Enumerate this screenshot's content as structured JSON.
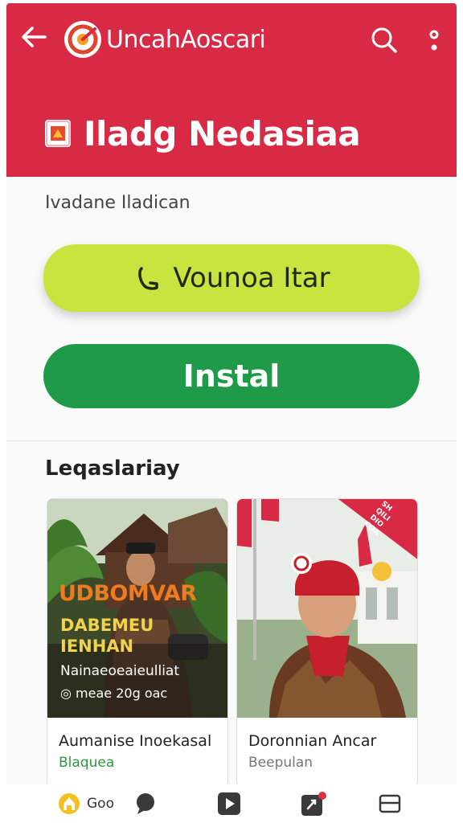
{
  "header": {
    "app_name": "UncahAoscari",
    "title": "Iladg Nedasiaa",
    "bg_color": "#d92a45"
  },
  "icons": {
    "back": "arrow-left-icon",
    "search": "search-icon",
    "more": "more-vertical-icon"
  },
  "subtitle": "Ivadane Iladican",
  "buttons": {
    "update_label": "Vounoa Itar",
    "install_label": "Instal"
  },
  "section": {
    "title": "Leqaslariay"
  },
  "cards": [
    {
      "title": "Aumanise Inoekasal",
      "meta": "Blaquea",
      "overlay_lines": [
        "UDBOMVAR",
        "DABEMEU",
        "IENHAN",
        "Nainaeoeaieulliat",
        "◎ meae 20g oac"
      ]
    },
    {
      "title": "Doronnian Ancar",
      "meta": "Beepulan",
      "badge_lines": [
        "SH",
        "QILI",
        "DIO",
        "COA"
      ]
    }
  ],
  "nav": {
    "home_label": "Goo"
  }
}
